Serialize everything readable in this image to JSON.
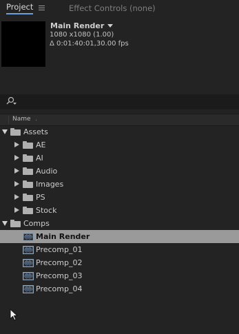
{
  "tabs": {
    "project_label": "Project",
    "effect_controls_label": "Effect Controls (none)"
  },
  "comp_info": {
    "title": "Main Render",
    "resolution": "1080 x1080 (1.00)",
    "duration": "Δ 0:01:40:01,30.00 fps"
  },
  "column_header": {
    "name": "Name",
    "extra": "."
  },
  "tree": [
    {
      "label": "Assets",
      "type": "folder",
      "expanded": true,
      "level": 0
    },
    {
      "label": "AE",
      "type": "folder",
      "expanded": false,
      "level": 1
    },
    {
      "label": "AI",
      "type": "folder",
      "expanded": false,
      "level": 1
    },
    {
      "label": "Audio",
      "type": "folder",
      "expanded": false,
      "level": 1
    },
    {
      "label": "Images",
      "type": "folder",
      "expanded": false,
      "level": 1
    },
    {
      "label": "PS",
      "type": "folder",
      "expanded": false,
      "level": 1
    },
    {
      "label": "Stock",
      "type": "folder",
      "expanded": false,
      "level": 1
    },
    {
      "label": "Comps",
      "type": "folder",
      "expanded": true,
      "level": 0
    },
    {
      "label": "Main Render",
      "type": "comp",
      "selected": true,
      "level": 1
    },
    {
      "label": "Precomp_01",
      "type": "comp",
      "level": 1
    },
    {
      "label": "Precomp_02",
      "type": "comp",
      "level": 1
    },
    {
      "label": "Precomp_03",
      "type": "comp",
      "level": 1
    },
    {
      "label": "Precomp_04",
      "type": "comp",
      "level": 1
    }
  ],
  "colors": {
    "panel_bg": "#232323",
    "selection": "#9a9a9a",
    "tab_underline": "#6aa0e0"
  }
}
